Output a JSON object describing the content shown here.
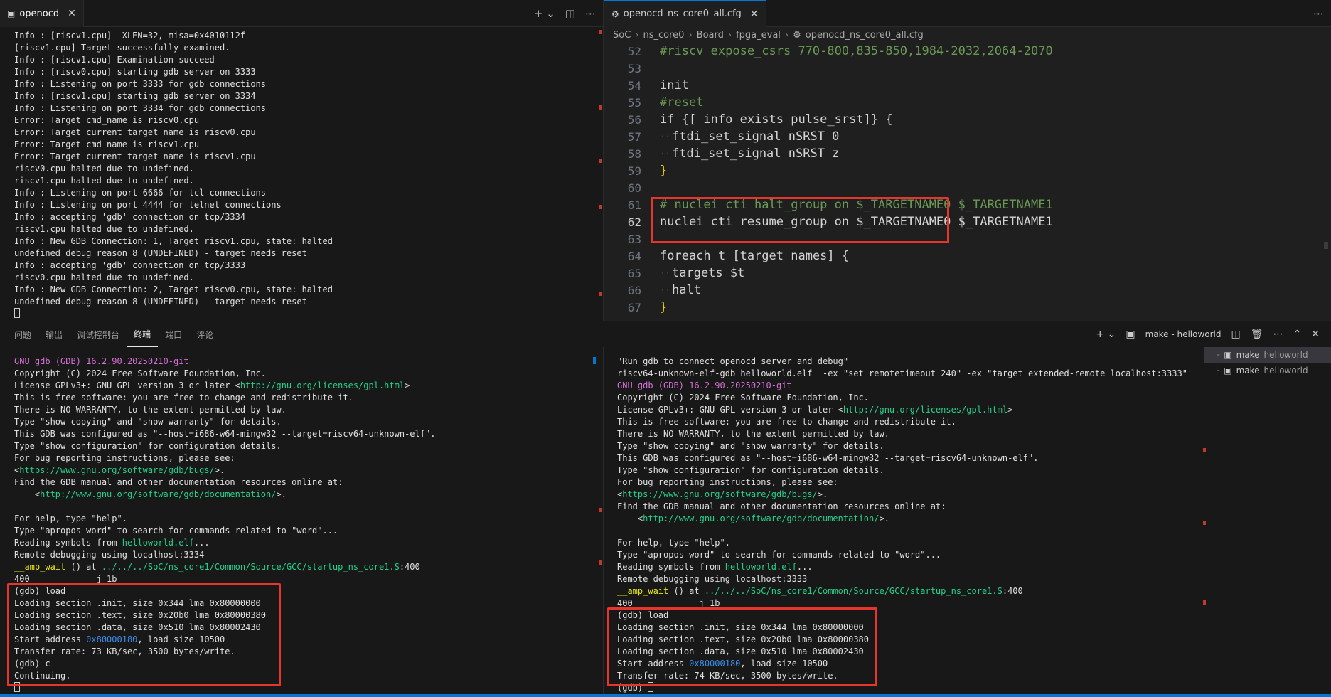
{
  "top_left": {
    "tab_title": "openocd",
    "tab_icon": "terminal-icon",
    "lines": [
      "Info : [riscv1.cpu]  XLEN=32, misa=0x4010112f",
      "[riscv1.cpu] Target successfully examined.",
      "Info : [riscv1.cpu] Examination succeed",
      "Info : [riscv0.cpu] starting gdb server on 3333",
      "Info : Listening on port 3333 for gdb connections",
      "Info : [riscv1.cpu] starting gdb server on 3334",
      "Info : Listening on port 3334 for gdb connections",
      "Error: Target cmd_name is riscv0.cpu",
      "Error: Target current_target_name is riscv0.cpu",
      "Error: Target cmd_name is riscv1.cpu",
      "Error: Target current_target_name is riscv1.cpu",
      "riscv0.cpu halted due to undefined.",
      "riscv1.cpu halted due to undefined.",
      "Info : Listening on port 6666 for tcl connections",
      "Info : Listening on port 4444 for telnet connections",
      "Info : accepting 'gdb' connection on tcp/3334",
      "riscv1.cpu halted due to undefined.",
      "Info : New GDB Connection: 1, Target riscv1.cpu, state: halted",
      "undefined debug reason 8 (UNDEFINED) - target needs reset",
      "Info : accepting 'gdb' connection on tcp/3333",
      "riscv0.cpu halted due to undefined.",
      "Info : New GDB Connection: 2, Target riscv0.cpu, state: halted",
      "undefined debug reason 8 (UNDEFINED) - target needs reset"
    ]
  },
  "top_right": {
    "tab_title": "openocd_ns_core0_all.cfg",
    "tab_icon": "gear-icon",
    "breadcrumb": [
      "SoC",
      "ns_core0",
      "Board",
      "fpga_eval",
      "openocd_ns_core0_all.cfg"
    ],
    "code_lines": [
      {
        "n": "52",
        "text": "#riscv expose_csrs 770-800,835-850,1984-2032,2064-2070",
        "kind": "comment"
      },
      {
        "n": "53",
        "text": "",
        "kind": "plain"
      },
      {
        "n": "54",
        "text": "init",
        "kind": "plain"
      },
      {
        "n": "55",
        "text": "#reset",
        "kind": "comment"
      },
      {
        "n": "56",
        "text": "if {[ info exists pulse_srst]} {",
        "kind": "if"
      },
      {
        "n": "57",
        "text": "ftdi_set_signal nSRST 0",
        "kind": "indent"
      },
      {
        "n": "58",
        "text": "ftdi_set_signal nSRST z",
        "kind": "indent"
      },
      {
        "n": "59",
        "text": "}",
        "kind": "brace"
      },
      {
        "n": "60",
        "text": "",
        "kind": "plain"
      },
      {
        "n": "61",
        "text": "# nuclei cti halt_group on $_TARGETNAME0 $_TARGETNAME1",
        "kind": "comment"
      },
      {
        "n": "62",
        "text": "nuclei cti resume_group on $_TARGETNAME0 $_TARGETNAME1",
        "kind": "plain"
      },
      {
        "n": "63",
        "text": "",
        "kind": "plain"
      },
      {
        "n": "64",
        "text": "foreach t [target names] {",
        "kind": "foreach"
      },
      {
        "n": "65",
        "text": "targets $t",
        "kind": "indent"
      },
      {
        "n": "66",
        "text": "halt",
        "kind": "indent"
      },
      {
        "n": "67",
        "text": "}",
        "kind": "brace"
      }
    ]
  },
  "panel": {
    "tabs": [
      "问题",
      "输出",
      "调试控制台",
      "终端",
      "端口",
      "评论"
    ],
    "active_tab": "终端",
    "terminal_name": "make - helloworld",
    "terminal_list": [
      {
        "name": "make",
        "sub": "helloworld"
      },
      {
        "name": "make",
        "sub": "helloworld"
      }
    ]
  },
  "gdb_left": [
    [
      {
        "t": "GNU gdb (GDB) 16.2.90.20250210-git",
        "c": "pink"
      }
    ],
    [
      {
        "t": "Copyright (C) 2024 Free Software Foundation, Inc."
      }
    ],
    [
      {
        "t": "License GPLv3+: GNU GPL version 3 or later <"
      },
      {
        "t": "http://gnu.org/licenses/gpl.html",
        "c": "link"
      },
      {
        "t": ">"
      }
    ],
    [
      {
        "t": "This is free software: you are free to change and redistribute it."
      }
    ],
    [
      {
        "t": "There is NO WARRANTY, to the extent permitted by law."
      }
    ],
    [
      {
        "t": "Type \"show copying\" and \"show warranty\" for details."
      }
    ],
    [
      {
        "t": "This GDB was configured as \"--host=i686-w64-mingw32 --target=riscv64-unknown-elf\"."
      }
    ],
    [
      {
        "t": "Type \"show configuration\" for configuration details."
      }
    ],
    [
      {
        "t": "For bug reporting instructions, please see:"
      }
    ],
    [
      {
        "t": "<"
      },
      {
        "t": "https://www.gnu.org/software/gdb/bugs/",
        "c": "green"
      },
      {
        "t": ">."
      }
    ],
    [
      {
        "t": "Find the GDB manual and other documentation resources online at:"
      }
    ],
    [
      {
        "t": "    <"
      },
      {
        "t": "http://www.gnu.org/software/gdb/documentation/",
        "c": "green"
      },
      {
        "t": ">."
      }
    ],
    [
      {
        "t": ""
      }
    ],
    [
      {
        "t": "For help, type \"help\"."
      }
    ],
    [
      {
        "t": "Type \"apropos word\" to search for commands related to \"word\"..."
      }
    ],
    [
      {
        "t": "Reading symbols from "
      },
      {
        "t": "helloworld.elf",
        "c": "green"
      },
      {
        "t": "..."
      }
    ],
    [
      {
        "t": "Remote debugging using localhost:3334"
      }
    ],
    [
      {
        "t": "__amp_wait",
        "c": "yellow"
      },
      {
        "t": " () at "
      },
      {
        "t": "../../../SoC/ns_core1/Common/Source/GCC/startup_ns_core1.S",
        "c": "green"
      },
      {
        "t": ":400"
      }
    ],
    [
      {
        "t": "400             j 1b"
      }
    ],
    [
      {
        "t": "(gdb) load"
      }
    ],
    [
      {
        "t": "Loading section .init, size 0x344 lma 0x80000000"
      }
    ],
    [
      {
        "t": "Loading section .text, size 0x20b0 lma 0x80000380"
      }
    ],
    [
      {
        "t": "Loading section .data, size 0x510 lma 0x80002430"
      }
    ],
    [
      {
        "t": "Start address "
      },
      {
        "t": "0x80000180",
        "c": "blue"
      },
      {
        "t": ", load size 10500"
      }
    ],
    [
      {
        "t": "Transfer rate: 73 KB/sec, 3500 bytes/write."
      }
    ],
    [
      {
        "t": "(gdb) c"
      }
    ],
    [
      {
        "t": "Continuing."
      }
    ]
  ],
  "gdb_right": [
    [
      {
        "t": "\"Run gdb to connect openocd server and debug\""
      }
    ],
    [
      {
        "t": "riscv64-unknown-elf-gdb helloworld.elf  -ex \"set remotetimeout 240\" -ex \"target extended-remote localhost:3333\""
      }
    ],
    [
      {
        "t": "GNU gdb (GDB) 16.2.90.20250210-git",
        "c": "pink"
      }
    ],
    [
      {
        "t": "Copyright (C) 2024 Free Software Foundation, Inc."
      }
    ],
    [
      {
        "t": "License GPLv3+: GNU GPL version 3 or later <"
      },
      {
        "t": "http://gnu.org/licenses/gpl.html",
        "c": "link"
      },
      {
        "t": ">"
      }
    ],
    [
      {
        "t": "This is free software: you are free to change and redistribute it."
      }
    ],
    [
      {
        "t": "There is NO WARRANTY, to the extent permitted by law."
      }
    ],
    [
      {
        "t": "Type \"show copying\" and \"show warranty\" for details."
      }
    ],
    [
      {
        "t": "This GDB was configured as \"--host=i686-w64-mingw32 --target=riscv64-unknown-elf\"."
      }
    ],
    [
      {
        "t": "Type \"show configuration\" for configuration details."
      }
    ],
    [
      {
        "t": "For bug reporting instructions, please see:"
      }
    ],
    [
      {
        "t": "<"
      },
      {
        "t": "https://www.gnu.org/software/gdb/bugs/",
        "c": "green"
      },
      {
        "t": ">."
      }
    ],
    [
      {
        "t": "Find the GDB manual and other documentation resources online at:"
      }
    ],
    [
      {
        "t": "    <"
      },
      {
        "t": "http://www.gnu.org/software/gdb/documentation/",
        "c": "green"
      },
      {
        "t": ">."
      }
    ],
    [
      {
        "t": ""
      }
    ],
    [
      {
        "t": "For help, type \"help\"."
      }
    ],
    [
      {
        "t": "Type \"apropos word\" to search for commands related to \"word\"..."
      }
    ],
    [
      {
        "t": "Reading symbols from "
      },
      {
        "t": "helloworld.elf",
        "c": "green"
      },
      {
        "t": "..."
      }
    ],
    [
      {
        "t": "Remote debugging using localhost:3333"
      }
    ],
    [
      {
        "t": "__amp_wait",
        "c": "yellow"
      },
      {
        "t": " () at "
      },
      {
        "t": "../../../SoC/ns_core1/Common/Source/GCC/startup_ns_core1.S",
        "c": "green"
      },
      {
        "t": ":400"
      }
    ],
    [
      {
        "t": "400             j 1b"
      }
    ],
    [
      {
        "t": "(gdb) load"
      }
    ],
    [
      {
        "t": "Loading section .init, size 0x344 lma 0x80000000"
      }
    ],
    [
      {
        "t": "Loading section .text, size 0x20b0 lma 0x80000380"
      }
    ],
    [
      {
        "t": "Loading section .data, size 0x510 lma 0x80002430"
      }
    ],
    [
      {
        "t": "Start address "
      },
      {
        "t": "0x80000180",
        "c": "blue"
      },
      {
        "t": ", load size 10500"
      }
    ],
    [
      {
        "t": "Transfer rate: 74 KB/sec, 3500 bytes/write."
      }
    ],
    [
      {
        "t": "(gdb) "
      }
    ]
  ],
  "colors": {
    "highlight_box": "#e5352d",
    "accent": "#0078d4",
    "comment": "#6a9955",
    "gdb_banner": "#d670d6",
    "link": "#23d18b"
  }
}
